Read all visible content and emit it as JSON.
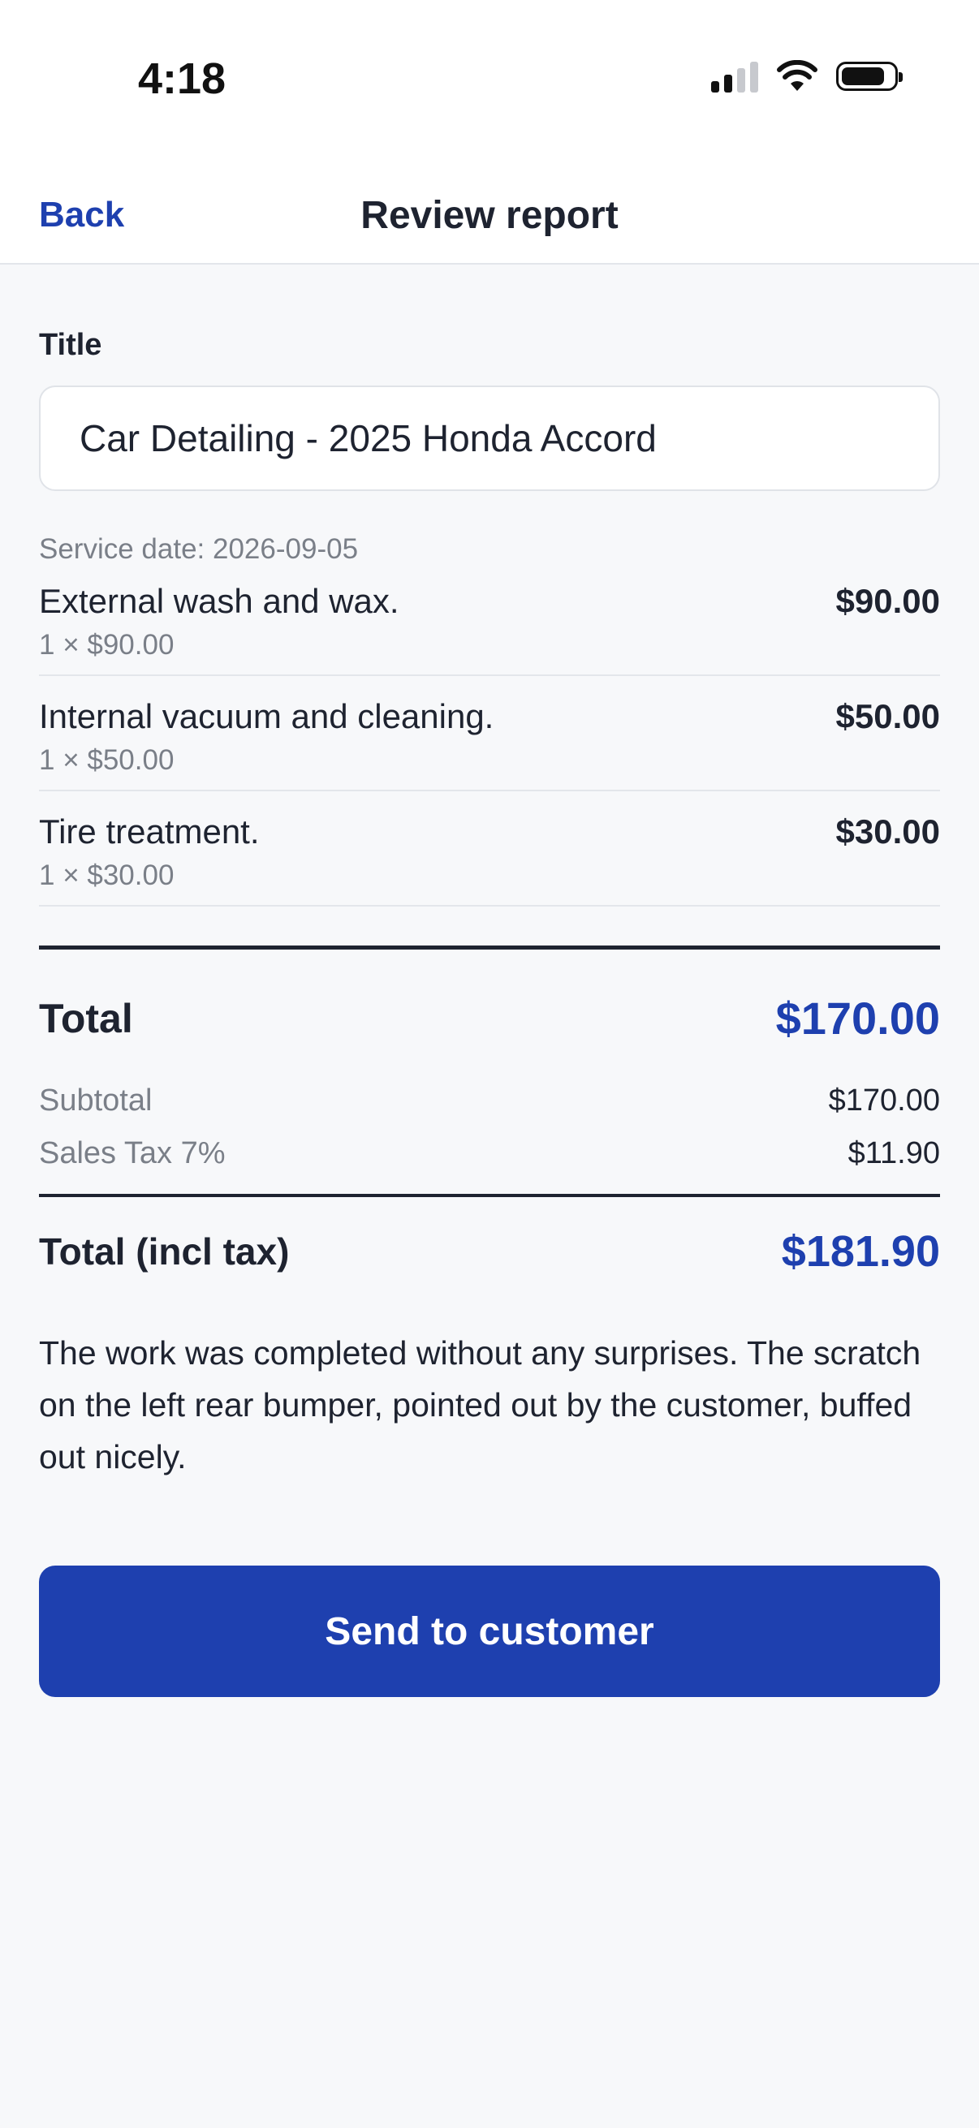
{
  "status_bar": {
    "time": "4:18",
    "signal_icon": "cellular-signal-icon",
    "wifi_icon": "wifi-icon",
    "battery_icon": "battery-icon"
  },
  "nav": {
    "back_label": "Back",
    "title": "Review report"
  },
  "form": {
    "title_label": "Title",
    "title_value": "Car Detailing - 2025 Honda Accord",
    "service_date": "Service date: 2026-09-05"
  },
  "line_items": [
    {
      "name": "External wash and wax.",
      "qty": "1 × $90.00",
      "amount": "$90.00"
    },
    {
      "name": "Internal vacuum and cleaning.",
      "qty": "1 × $50.00",
      "amount": "$50.00"
    },
    {
      "name": "Tire treatment.",
      "qty": "1 × $30.00",
      "amount": "$30.00"
    }
  ],
  "totals": {
    "total_label": "Total",
    "total_value": "$170.00",
    "subtotal_label": "Subtotal",
    "subtotal_value": "$170.00",
    "tax_label": "Sales Tax 7%",
    "tax_value": "$11.90",
    "total_incl_label": "Total (incl tax)",
    "total_incl_value": "$181.90"
  },
  "notes": "The work was completed without any surprises. The scratch on the left rear bumper, pointed out by the customer, buffed out nicely.",
  "actions": {
    "send_label": "Send to customer"
  },
  "colors": {
    "accent": "#1e40af",
    "background": "#f7f8fa",
    "text": "#1e2330",
    "muted": "#7a7f88"
  }
}
